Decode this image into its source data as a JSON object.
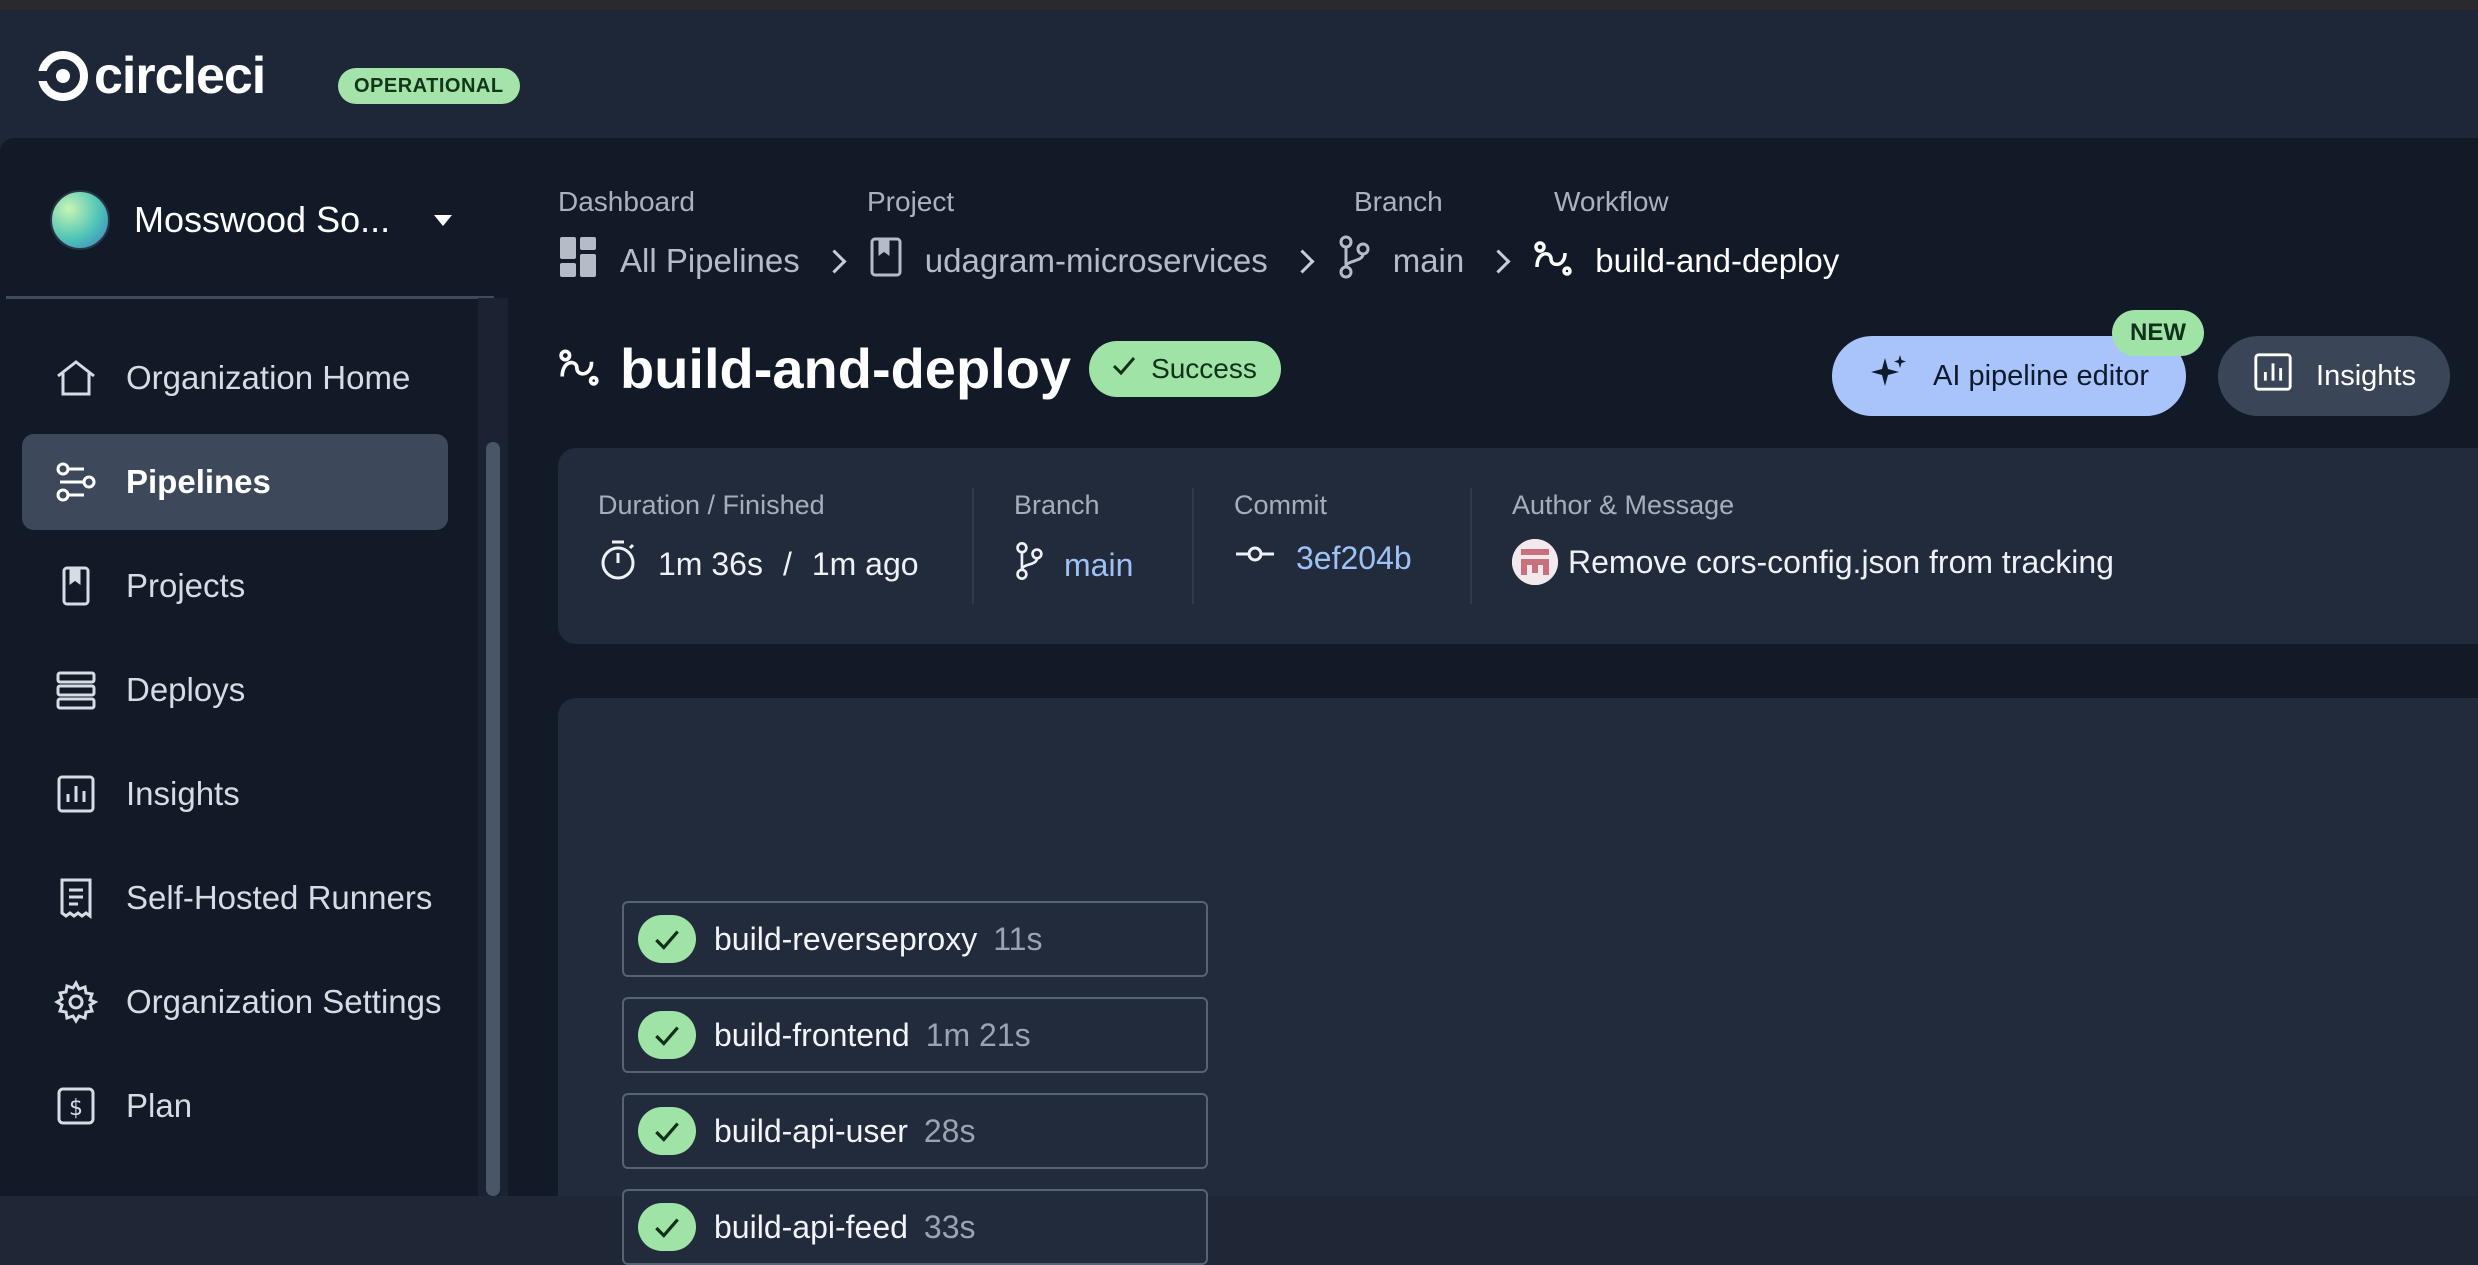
{
  "brand": {
    "logo_text": "circleci",
    "status": "OPERATIONAL"
  },
  "org": {
    "name": "Mosswood So..."
  },
  "nav": [
    {
      "label": "Organization Home",
      "icon": "home-icon",
      "active": false
    },
    {
      "label": "Pipelines",
      "icon": "pipelines-icon",
      "active": true
    },
    {
      "label": "Projects",
      "icon": "bookmark-icon",
      "active": false
    },
    {
      "label": "Deploys",
      "icon": "deploys-icon",
      "active": false
    },
    {
      "label": "Insights",
      "icon": "chart-icon",
      "active": false
    },
    {
      "label": "Self-Hosted Runners",
      "icon": "runner-icon",
      "active": false
    },
    {
      "label": "Organization Settings",
      "icon": "gear-icon",
      "active": false
    },
    {
      "label": "Plan",
      "icon": "dollar-icon",
      "active": false
    }
  ],
  "breadcrumb": {
    "labels": [
      "Dashboard",
      "Project",
      "Branch",
      "Workflow"
    ],
    "items": [
      "All Pipelines",
      "udagram-microservices",
      "main",
      "build-and-deploy"
    ]
  },
  "workflow": {
    "title": "build-and-deploy",
    "status": "Success",
    "ai_button": "AI pipeline editor",
    "new_badge": "NEW",
    "insights_button": "Insights"
  },
  "summary": {
    "duration_label": "Duration / Finished",
    "duration": "1m 36s",
    "separator": "/",
    "finished": "1m ago",
    "branch_label": "Branch",
    "branch": "main",
    "commit_label": "Commit",
    "commit": "3ef204b",
    "author_label": "Author & Message",
    "message": "Remove cors-config.json from tracking"
  },
  "jobs": [
    {
      "name": "build-reverseproxy",
      "duration": "11s"
    },
    {
      "name": "build-frontend",
      "duration": "1m 21s"
    },
    {
      "name": "build-api-user",
      "duration": "28s"
    },
    {
      "name": "build-api-feed",
      "duration": "33s"
    }
  ],
  "colors": {
    "success": "#9fe3a7",
    "accent": "#a9c4fb",
    "link": "#9ec2f7"
  }
}
